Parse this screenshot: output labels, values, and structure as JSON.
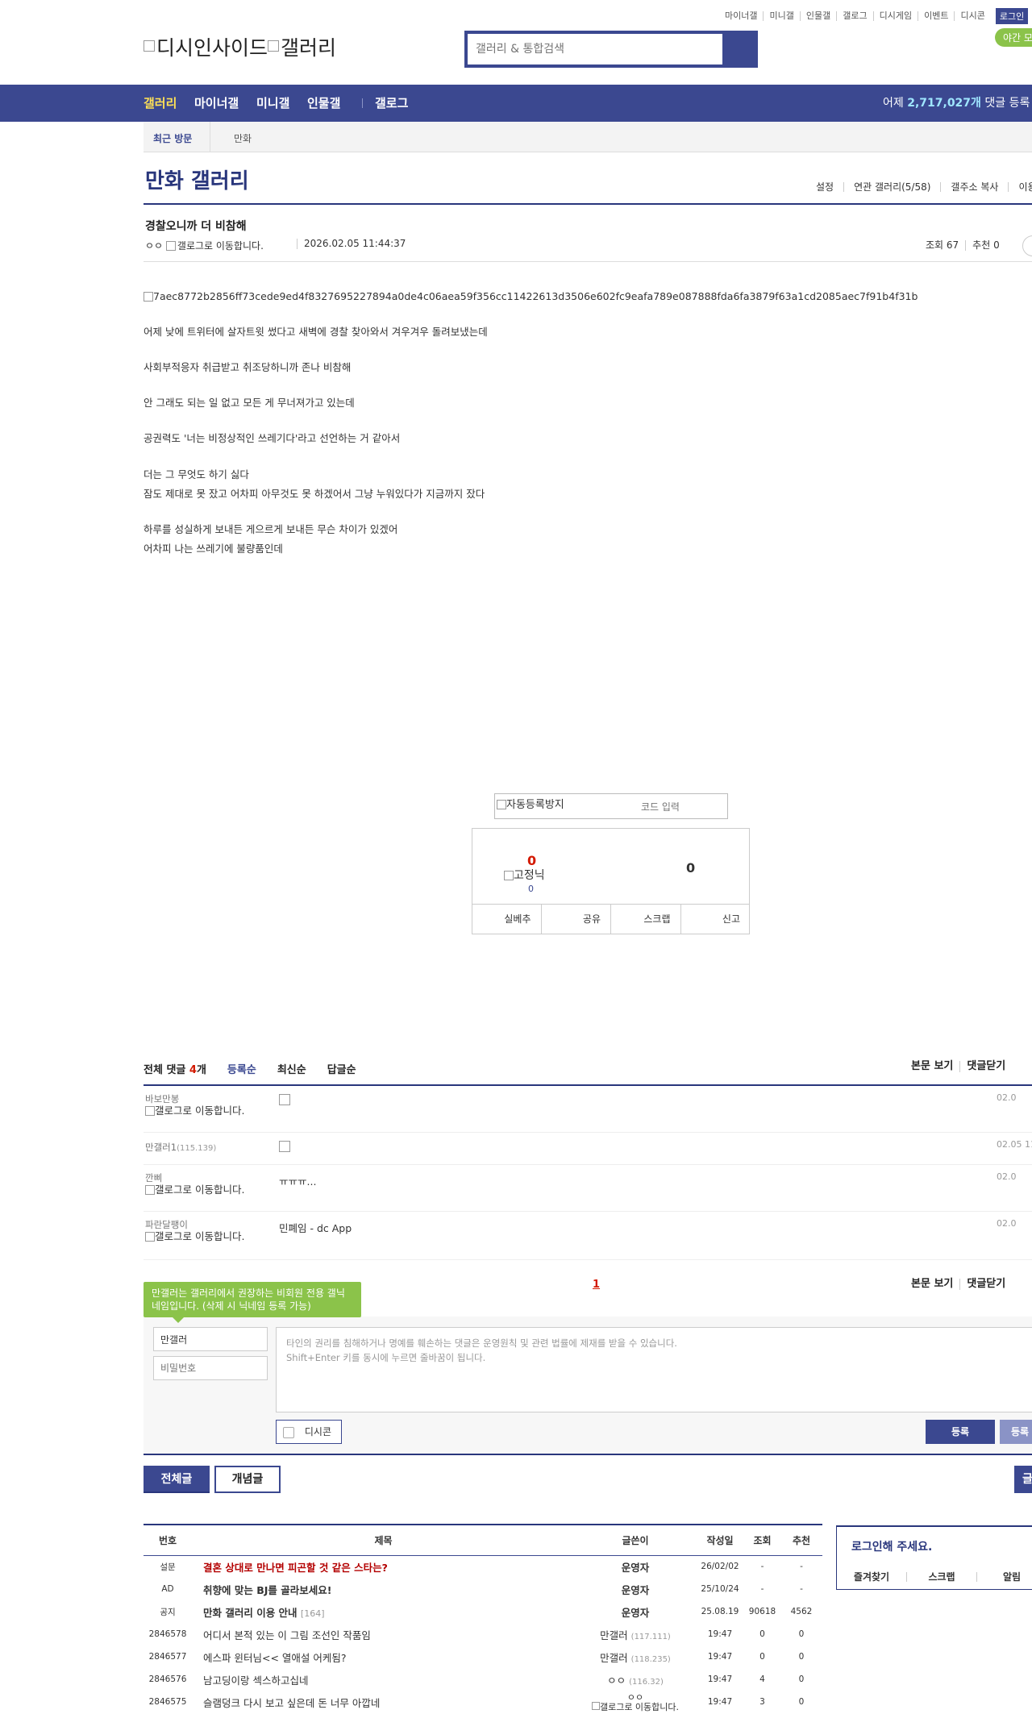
{
  "header": {
    "top_menu": [
      "마이너갤",
      "미니갤",
      "인물갤",
      "갤로그",
      "디시게임",
      "이벤트",
      "디시콘"
    ],
    "login": "로그인",
    "night_mode": "야간 모",
    "logo_text": "디시인사이드",
    "logo_gallery": "갤러리",
    "search_placeholder": "갤러리 & 통합검색",
    "nav": [
      "갤러리",
      "마이너갤",
      "미니갤",
      "인물갤",
      "갤로그"
    ],
    "visitors_prefix": "어제 ",
    "visitors_count": "2,717,027개",
    "visitors_suffix": " 댓글 등록",
    "recent_label": "최근 방문",
    "recent_item": "만화"
  },
  "gallery": {
    "title": "만화 갤러리",
    "tools": [
      "설정",
      "연관 갤러리(5/58)",
      "갤주소 복사",
      "이용"
    ]
  },
  "post": {
    "title": "경찰오니까 더 비참해",
    "writer": "ㅇㅇ",
    "gallog_alt": "갤로그로 이동합니다.",
    "date": "2026.02.05 11:44:37",
    "views": "조회 67",
    "recommend": "추천 0",
    "image_alt": "7aec8772b2856ff73cede9ed4f8327695227894a0de4c06aea59f356cc11422613d3506e602fc9eafa789e087888fda6fa3879f63a1cd2085aec7f91b4f31b",
    "paragraphs": [
      "어제 낮에 트위터에 살자트윗 썼다고 새벽에 경찰 찾아와서 겨우겨우 돌려보냈는데",
      "사회부적응자 취급받고 취조당하니까 존나 비참해",
      "안 그래도 되는 일 없고 모든 게 무너져가고 있는데",
      "공권력도 '너는 비정상적인 쓰레기다'라고 선언하는 거 같아서",
      "더는 그 무엇도 하기 싫다",
      "잠도 제대로 못 잤고 어차피 아무것도 못 하겠어서 그냥 누워있다가 지금까지 잤다",
      "하루를 성실하게 보내든 게으르게 보내든 무슨 차이가 있겠어",
      "어차피 나는 쓰레기에 불량품인데"
    ]
  },
  "captcha": {
    "image_alt": "자동등록방지",
    "placeholder": "코드 입력"
  },
  "recommend_box": {
    "up": "0",
    "fixed_alt": "고정닉",
    "fixed_count": "0",
    "down": "0",
    "buttons": [
      "실베추",
      "공유",
      "스크랩",
      "신고"
    ]
  },
  "comments": {
    "total_label": "전체 댓글 ",
    "total_count": "4",
    "total_unit": "개",
    "sorts": [
      "등록순",
      "최신순",
      "답글순"
    ],
    "right_links": [
      "본문 보기",
      "댓글닫기"
    ],
    "items": [
      {
        "name": "바보만봉",
        "ip": "",
        "gallog": "갤로그로 이동합니다.",
        "text": "",
        "date": "02.0"
      },
      {
        "name": "만갤러1",
        "ip": "(115.139)",
        "gallog": "",
        "text": "",
        "date": "02.05 11"
      },
      {
        "name": "깐삐",
        "ip": "",
        "gallog": "갤로그로 이동합니다.",
        "text": "ㅠㅠㅠ...",
        "date": "02.0"
      },
      {
        "name": "파란달팽이",
        "ip": "",
        "gallog": "갤로그로 이동합니다.",
        "text": "민폐임 - dc App",
        "date": "02.0"
      }
    ],
    "page": "1",
    "tip": "만갤러는 갤러리에서 권장하는 비회원 전용 갤닉네임입니다. (삭제 시 닉네임 등록 가능)",
    "name_value": "만갤러",
    "pw_placeholder": "비밀번호",
    "textarea_line1": "타인의 권리를 침해하거나 명예를 훼손하는 댓글은 운영원칙 및 관련 법률에 제재를 받을 수 있습니다.",
    "textarea_line2": "Shift+Enter 키를 동시에 누르면 줄바꿈이 됩니다.",
    "dccon": "디시콘",
    "submit": "등록",
    "submit2": "등록"
  },
  "list": {
    "tab_all": "전체글",
    "tab_recommend": "개념글",
    "tab_right": "글",
    "headers": [
      "번호",
      "제목",
      "글쓴이",
      "작성일",
      "조회",
      "추천"
    ],
    "rows": [
      {
        "num": "설문",
        "subject": "결혼 상대로 만나면 피곤할 것 같은 스타는?",
        "style": "red",
        "reply": "",
        "writer": "운영자",
        "ip": "",
        "date": "26/02/02",
        "views": "-",
        "rec": "-",
        "writer_bold": true
      },
      {
        "num": "AD",
        "subject": "취향에 맞는 BJ를 골라보세요!",
        "style": "bold",
        "reply": "",
        "writer": "운영자",
        "ip": "",
        "date": "25/10/24",
        "views": "-",
        "rec": "-",
        "writer_bold": true
      },
      {
        "num": "공지",
        "subject": "만화 갤러리 이용 안내",
        "style": "bold",
        "reply": "[164]",
        "writer": "운영자",
        "ip": "",
        "date": "25.08.19",
        "views": "90618",
        "rec": "4562",
        "writer_bold": true
      },
      {
        "num": "2846578",
        "subject": "어디서 본적 있는 이 그림 조선인 작품임",
        "style": "",
        "reply": "",
        "writer": "만갤러",
        "ip": "(117.111)",
        "date": "19:47",
        "views": "0",
        "rec": "0",
        "writer_bold": false
      },
      {
        "num": "2846577",
        "subject": "에스파 윈터님<< 열애설 어케됨?",
        "style": "",
        "reply": "",
        "writer": "만갤러",
        "ip": "(118.235)",
        "date": "19:47",
        "views": "0",
        "rec": "0",
        "writer_bold": false
      },
      {
        "num": "2846576",
        "subject": "남고딩이랑 섹스하고십네",
        "style": "",
        "reply": "",
        "writer": "ㅇㅇ",
        "ip": "(116.32)",
        "date": "19:47",
        "views": "4",
        "rec": "0",
        "writer_bold": false
      },
      {
        "num": "2846575",
        "subject": "슬램덩크 다시 보고 싶은데 돈 너무 아깝네",
        "style": "",
        "reply": "",
        "writer": "ㅇㅇ",
        "ip": "",
        "date": "19:47",
        "views": "3",
        "rec": "0",
        "writer_bold": false
      }
    ],
    "row_gallog": "갤로그로 이동합니다."
  },
  "side": {
    "title": "로그인해 주세요.",
    "links": [
      "즐겨찾기",
      "스크랩",
      "알림"
    ]
  },
  "colors": {
    "brand": "#3b4890",
    "brand_dark": "#29367c",
    "accent_red": "#d31900",
    "tip_green": "#8bc34a"
  }
}
